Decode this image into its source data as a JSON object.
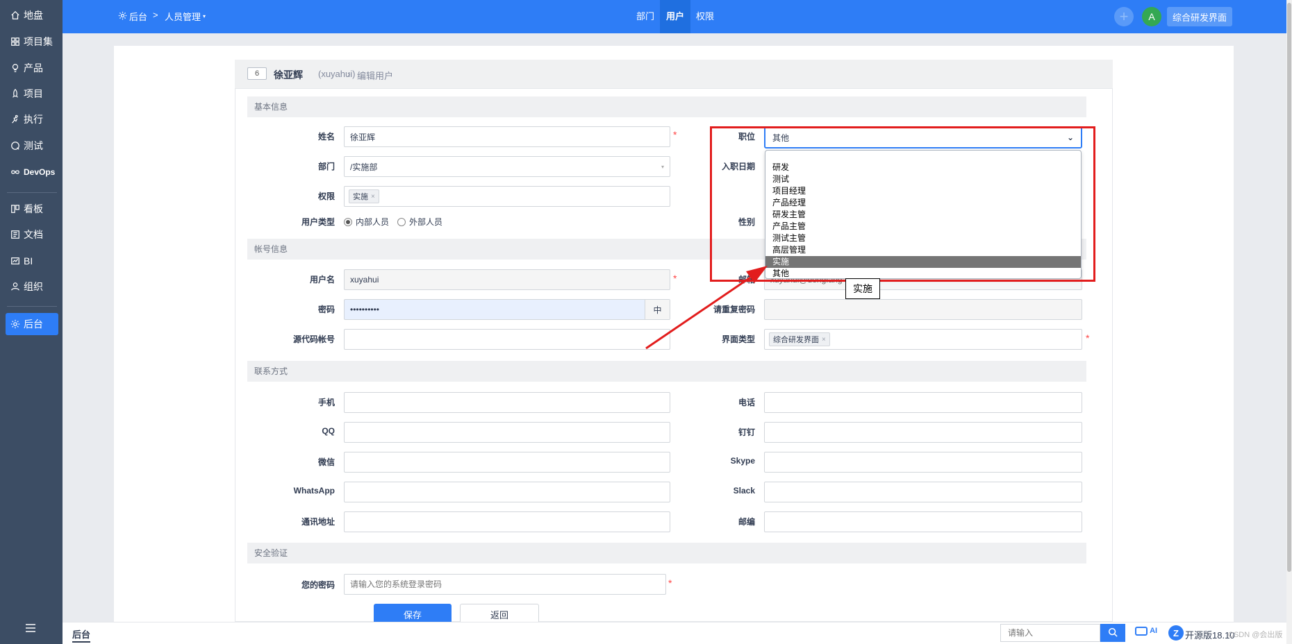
{
  "sidebar": {
    "items": [
      {
        "label": "地盘",
        "icon": "home-icon"
      },
      {
        "label": "项目集",
        "icon": "grid-icon"
      },
      {
        "label": "产品",
        "icon": "lightbulb-icon"
      },
      {
        "label": "项目",
        "icon": "rocket-icon"
      },
      {
        "label": "执行",
        "icon": "run-icon"
      },
      {
        "label": "测试",
        "icon": "test-icon"
      },
      {
        "label": "DevOps",
        "icon": "infinity-icon"
      },
      {
        "label": "看板",
        "icon": "kanban-icon"
      },
      {
        "label": "文档",
        "icon": "doc-icon"
      },
      {
        "label": "BI",
        "icon": "chart-icon"
      },
      {
        "label": "组织",
        "icon": "users-icon"
      },
      {
        "label": "后台",
        "icon": "gear-icon"
      }
    ],
    "active": "后台"
  },
  "header": {
    "crumb_home": "后台",
    "crumb_sep": ">",
    "crumb_module": "人员管理",
    "tabs": [
      "部门",
      "用户",
      "权限"
    ],
    "active_tab": "用户",
    "avatar_letter": "A",
    "ui_mode": "综合研发界面",
    "colors": {
      "primary": "#2e7df6",
      "sidebar": "#3c4d64"
    }
  },
  "title": {
    "id": "6",
    "name": "徐亚辉",
    "account": "(xuyahui)",
    "sep": "›",
    "action": "编辑用户"
  },
  "sections": {
    "basic": "基本信息",
    "account": "帐号信息",
    "contact": "联系方式",
    "security": "安全验证"
  },
  "form": {
    "name_label": "姓名",
    "name_value": "徐亚辉",
    "dept_label": "部门",
    "dept_value": "/实施部",
    "priv_label": "权限",
    "priv_tag": "实施",
    "usertype_label": "用户类型",
    "usertype_inside": "内部人员",
    "usertype_outside": "外部人员",
    "position_label": "职位",
    "position_value": "其他",
    "join_label": "入职日期",
    "gender_label": "性别",
    "username_label": "用户名",
    "username_value": "xuyahui",
    "email_label": "邮箱",
    "email_value": "xuyahui@dongfang",
    "password_label": "密码",
    "password_value": "••••••••••",
    "password_strength": "中",
    "repeat_label": "请重复密码",
    "commiter_label": "源代码帐号",
    "vision_label": "界面类型",
    "vision_tag": "综合研发界面",
    "mobile_label": "手机",
    "phone_label": "电话",
    "qq_label": "QQ",
    "dingding_label": "钉钉",
    "weixin_label": "微信",
    "skype_label": "Skype",
    "whatsapp_label": "WhatsApp",
    "slack_label": "Slack",
    "address_label": "通讯地址",
    "zipcode_label": "邮编",
    "verify_label": "您的密码",
    "verify_placeholder": "请输入您的系统登录密码",
    "required_mark": "*"
  },
  "position_options": [
    "研发",
    "测试",
    "项目经理",
    "产品经理",
    "研发主管",
    "产品主管",
    "测试主管",
    "高层管理",
    "实施",
    "其他"
  ],
  "position_highlight": "实施",
  "tooltip": "实施",
  "buttons": {
    "save": "保存",
    "back": "返回"
  },
  "footer": {
    "crumb": "后台",
    "search_placeholder": "请输入",
    "ai": "AI",
    "version": "开源版18.10",
    "watermark": "CSDN @会出版"
  }
}
